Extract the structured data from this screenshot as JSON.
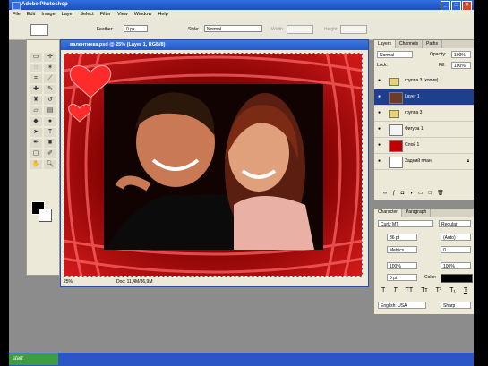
{
  "app": {
    "title": "Adobe Photoshop"
  },
  "menu": [
    "File",
    "Edit",
    "Image",
    "Layer",
    "Select",
    "Filter",
    "View",
    "Window",
    "Help"
  ],
  "options": {
    "feather_label": "Feather:",
    "feather_value": "0 px",
    "style_label": "Style:",
    "style_value": "Normal",
    "width_label": "Width:",
    "height_label": "Height:"
  },
  "document": {
    "title": "валентинка.psd @ 25% (Layer 1, RGB/8)",
    "zoom": "25%",
    "info": "Doc: 11,4M/86,9M"
  },
  "layers_panel": {
    "tabs": [
      "Layers",
      "Channels",
      "Paths"
    ],
    "blend_mode": "Normal",
    "opacity_label": "Opacity:",
    "opacity": "100%",
    "lock_label": "Lock:",
    "fill_label": "Fill:",
    "fill": "100%",
    "layers": [
      {
        "name": "группа 3 (копия)",
        "selected": false
      },
      {
        "name": "Layer 1",
        "selected": true
      },
      {
        "name": "группа 3",
        "selected": false
      },
      {
        "name": "Фигура 1",
        "selected": false
      },
      {
        "name": "Слой 1",
        "selected": false
      },
      {
        "name": "Задний план",
        "selected": false
      }
    ]
  },
  "character_panel": {
    "tabs": [
      "Character",
      "Paragraph"
    ],
    "font_family": "Curlz MT",
    "font_style": "Regular",
    "font_size": "36 pt",
    "leading": "(Auto)",
    "kerning": "Metrics",
    "tracking": "0",
    "vscale": "100%",
    "hscale": "100%",
    "baseline": "0 pt",
    "color_label": "Color:",
    "language": "English: USA",
    "antialias": "Sharp"
  },
  "taskbar": {
    "start_label": "start"
  }
}
